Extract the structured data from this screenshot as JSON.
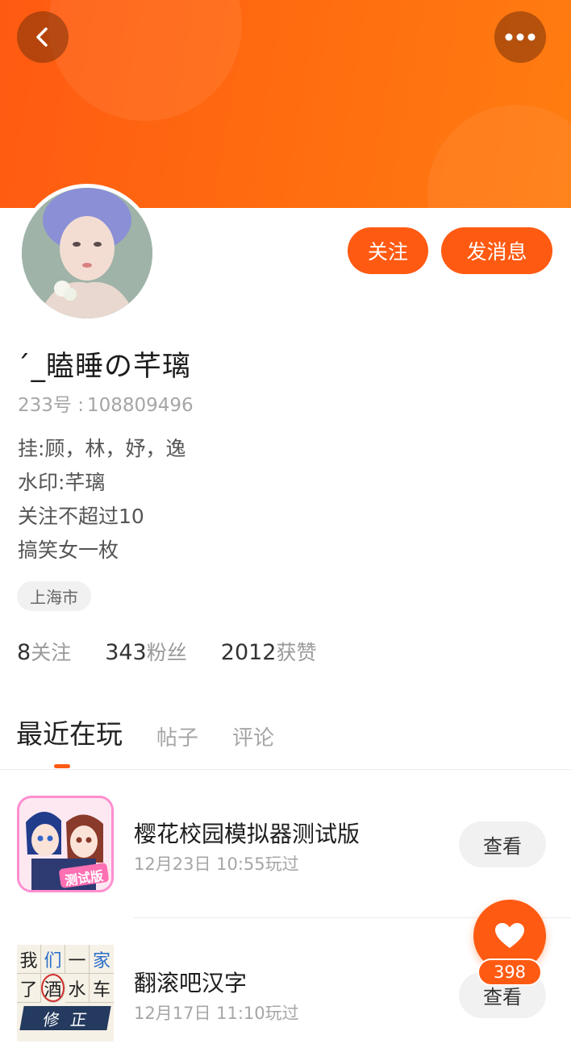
{
  "header": {
    "back_icon": "chevron-left-icon",
    "more_icon": "more-horizontal-icon",
    "gradient_start": "#ff5a12",
    "gradient_end": "#ff7d10"
  },
  "profile": {
    "username": "ˊ_瞌睡の芊璃",
    "uid_label": "233号 :",
    "uid_value": "108809496",
    "bio_lines": [
      "挂:顾，林，妤，逸",
      "水印:芊璃",
      "关注不超过10",
      "搞笑女一枚"
    ],
    "location": "上海市"
  },
  "actions": {
    "follow_label": "关注",
    "message_label": "发消息",
    "accent": "#ff5a12"
  },
  "stats": [
    {
      "num": "8",
      "label": "关注"
    },
    {
      "num": "343",
      "label": "粉丝"
    },
    {
      "num": "2012",
      "label": "获赞"
    }
  ],
  "tabs": [
    {
      "label": "最近在玩",
      "active": true
    },
    {
      "label": "帖子",
      "active": false
    },
    {
      "label": "评论",
      "active": false
    }
  ],
  "games": [
    {
      "name": "樱花校园模拟器测试版",
      "time": "12月23日 10:55玩过",
      "button": "查看",
      "icon_badge": "测试版"
    },
    {
      "name": "翻滚吧汉字",
      "time": "12月17日 11:10玩过",
      "button": "查看",
      "icon_chars": [
        "我",
        "们",
        "一",
        "家",
        "了",
        "酒",
        "水",
        "车",
        "修",
        "正"
      ]
    }
  ],
  "like_fab": {
    "icon": "heart-icon",
    "count": "398"
  }
}
